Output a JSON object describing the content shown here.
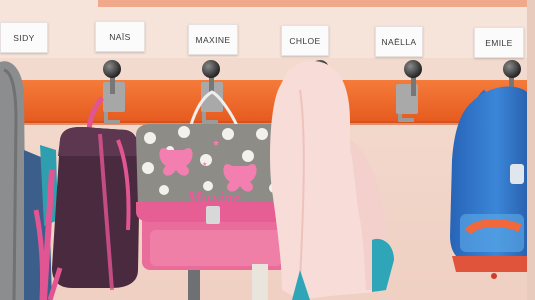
{
  "photo": {
    "name_labels": [
      "SIDY",
      "NAÏS",
      "MAXINE",
      "CHLOE",
      "NAËLLA",
      "EMILE"
    ],
    "bag_name": "Maxine"
  },
  "colors": {
    "wall": "#f2d8cc",
    "coat_rail": "#f26a2a",
    "top_stripe": "#f0a98a",
    "bag_pink": "#ea6c9a",
    "bag_grey": "#8e8c86",
    "cardigan": "#f8dcd8",
    "backpack_blue": "#2f73c6",
    "backpack_purple": "#4a2a3e"
  },
  "icons": [
    "coat-hook"
  ]
}
